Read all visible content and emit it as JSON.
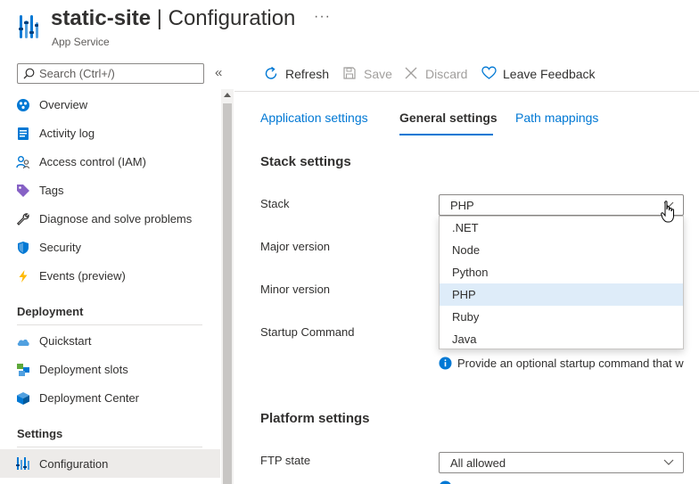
{
  "header": {
    "site_name": "static-site",
    "separator": "|",
    "page_name": "Configuration",
    "subtitle": "App Service",
    "more": "···"
  },
  "sidebar": {
    "search_placeholder": "Search (Ctrl+/)",
    "collapse": "«",
    "items": [
      {
        "label": "Overview",
        "icon": "overview-icon"
      },
      {
        "label": "Activity log",
        "icon": "activity-log-icon"
      },
      {
        "label": "Access control (IAM)",
        "icon": "iam-icon"
      },
      {
        "label": "Tags",
        "icon": "tag-icon"
      },
      {
        "label": "Diagnose and solve problems",
        "icon": "wrench-icon"
      },
      {
        "label": "Security",
        "icon": "shield-icon"
      },
      {
        "label": "Events (preview)",
        "icon": "lightning-icon"
      }
    ],
    "sections": [
      {
        "title": "Deployment",
        "items": [
          {
            "label": "Quickstart",
            "icon": "cloud-icon"
          },
          {
            "label": "Deployment slots",
            "icon": "slots-icon"
          },
          {
            "label": "Deployment Center",
            "icon": "cube-icon"
          }
        ]
      },
      {
        "title": "Settings",
        "items": [
          {
            "label": "Configuration",
            "icon": "configuration-icon",
            "active": true
          }
        ]
      }
    ]
  },
  "toolbar": {
    "refresh": "Refresh",
    "save": "Save",
    "discard": "Discard",
    "feedback": "Leave Feedback"
  },
  "tabs": [
    {
      "label": "Application settings",
      "active": false
    },
    {
      "label": "General settings",
      "active": true
    },
    {
      "label": "Path mappings",
      "active": false
    }
  ],
  "stack_settings": {
    "heading": "Stack settings",
    "stack_label": "Stack",
    "stack_value": "PHP",
    "major_version_label": "Major version",
    "minor_version_label": "Minor version",
    "startup_command_label": "Startup Command",
    "startup_info": "Provide an optional startup command that w",
    "stack_options": [
      ".NET",
      "Node",
      "Python",
      "PHP",
      "Ruby",
      "Java"
    ],
    "selected_option": "PHP"
  },
  "platform_settings": {
    "heading": "Platform settings",
    "ftp_label": "FTP state",
    "ftp_value": "All allowed"
  },
  "colors": {
    "accent": "#0078d4",
    "selected_bg": "#deecf9",
    "active_nav_bg": "#edebe9"
  }
}
